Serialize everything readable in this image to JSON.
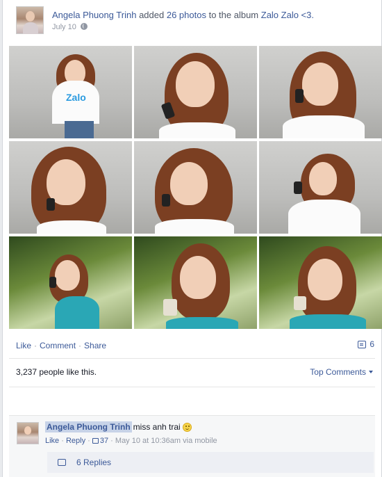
{
  "post": {
    "author": "Angela Phuong Trinh",
    "action_pre": "added",
    "photo_count": "26 photos",
    "action_mid": "to the album",
    "album": "Zalo Zalo <3.",
    "date": "July 10"
  },
  "actions": {
    "like": "Like",
    "comment": "Comment",
    "share": "Share",
    "sep": "·",
    "comment_count": "6"
  },
  "likes_text": "3,237 people like this.",
  "top_comments": "Top Comments",
  "comment": {
    "author": "Angela Phuong Trinh",
    "text": "miss anh trai",
    "like": "Like",
    "reply": "Reply",
    "like_count": "37",
    "time": "May 10 at 10:36am via mobile",
    "replies": "6 Replies"
  },
  "shirt_logo": "Zalo",
  "icons": [
    "globe-icon",
    "comment-icon",
    "caret-down-icon",
    "thumbs-up-icon",
    "smile-emoji-icon",
    "reply-icon"
  ]
}
